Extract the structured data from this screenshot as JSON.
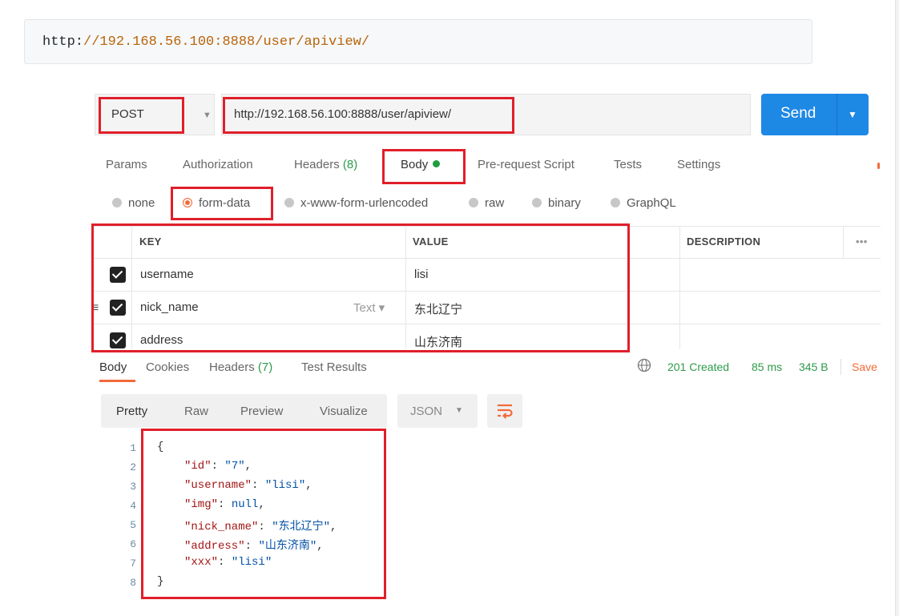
{
  "code_url": {
    "protocol": "http:",
    "rest": "//192.168.56.100:8888/user/apiview/"
  },
  "request": {
    "method": "POST",
    "url": "http://192.168.56.100:8888/user/apiview/",
    "send_label": "Send"
  },
  "request_tabs": {
    "params": "Params",
    "authorization": "Authorization",
    "headers": "Headers",
    "headers_count": "(8)",
    "body": "Body",
    "pre_request": "Pre-request Script",
    "tests": "Tests",
    "settings": "Settings"
  },
  "body_types": {
    "none": "none",
    "form_data": "form-data",
    "urlencoded": "x-www-form-urlencoded",
    "raw": "raw",
    "binary": "binary",
    "graphql": "GraphQL",
    "selected": "form-data"
  },
  "table": {
    "headers": {
      "key": "KEY",
      "value": "VALUE",
      "description": "DESCRIPTION",
      "more": "•••"
    },
    "type_label": "Text ▾",
    "rows": [
      {
        "key": "username",
        "value": "lisi"
      },
      {
        "key": "nick_name",
        "value": "东北辽宁"
      },
      {
        "key": "address",
        "value": "山东济南"
      }
    ]
  },
  "response_tabs": {
    "body": "Body",
    "cookies": "Cookies",
    "headers": "Headers",
    "headers_count": "(7)",
    "test_results": "Test Results"
  },
  "response_status": {
    "status": "201 Created",
    "time": "85 ms",
    "size": "345 B",
    "save": "Save"
  },
  "viewer": {
    "pretty": "Pretty",
    "raw": "Raw",
    "preview": "Preview",
    "visualize": "Visualize",
    "format": "JSON"
  },
  "response_code": {
    "line_numbers": [
      "1",
      "2",
      "3",
      "4",
      "5",
      "6",
      "7",
      "8"
    ],
    "open_brace": "{",
    "close_brace": "}",
    "lines": [
      {
        "key": "\"id\"",
        "value": "\"7\"",
        "comma": ","
      },
      {
        "key": "\"username\"",
        "value": "\"lisi\"",
        "comma": ","
      },
      {
        "key": "\"img\"",
        "value": "null",
        "comma": ","
      },
      {
        "key": "\"nick_name\"",
        "value": "\"东北辽宁\"",
        "comma": ","
      },
      {
        "key": "\"address\"",
        "value": "\"山东济南\"",
        "comma": ","
      },
      {
        "key": "\"xxx\"",
        "value": "\"lisi\"",
        "comma": ""
      }
    ]
  },
  "colors": {
    "accent_send": "#1e88e5",
    "highlight_red": "#e01f2a",
    "active_tab_orange": "#f26b3a",
    "status_green": "#2d9b4a"
  }
}
